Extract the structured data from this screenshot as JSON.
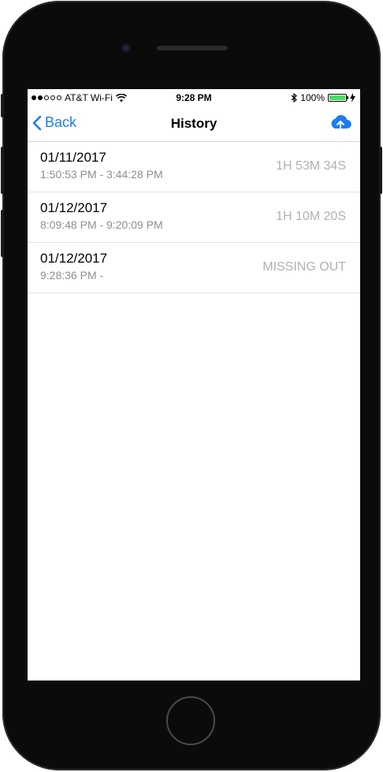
{
  "status_bar": {
    "carrier": "AT&T Wi-Fi",
    "time": "9:28 PM",
    "battery_text": "100%",
    "signal_bars": [
      true,
      true,
      false,
      false,
      false
    ]
  },
  "nav": {
    "back_label": "Back",
    "title": "History",
    "right_icon": "cloud-upload-icon"
  },
  "history": [
    {
      "date": "01/11/2017",
      "range": "1:50:53 PM - 3:44:28 PM",
      "duration": "1H 53M 34S"
    },
    {
      "date": "01/12/2017",
      "range": "8:09:48 PM - 9:20:09 PM",
      "duration": "1H 10M 20S"
    },
    {
      "date": "01/12/2017",
      "range": "9:28:36 PM -",
      "duration": "MISSING OUT"
    }
  ],
  "colors": {
    "accent": "#1c7cf2",
    "battery": "#4cd964",
    "secondary_text": "#8e8e93",
    "duration_text": "#b0b0b5"
  }
}
